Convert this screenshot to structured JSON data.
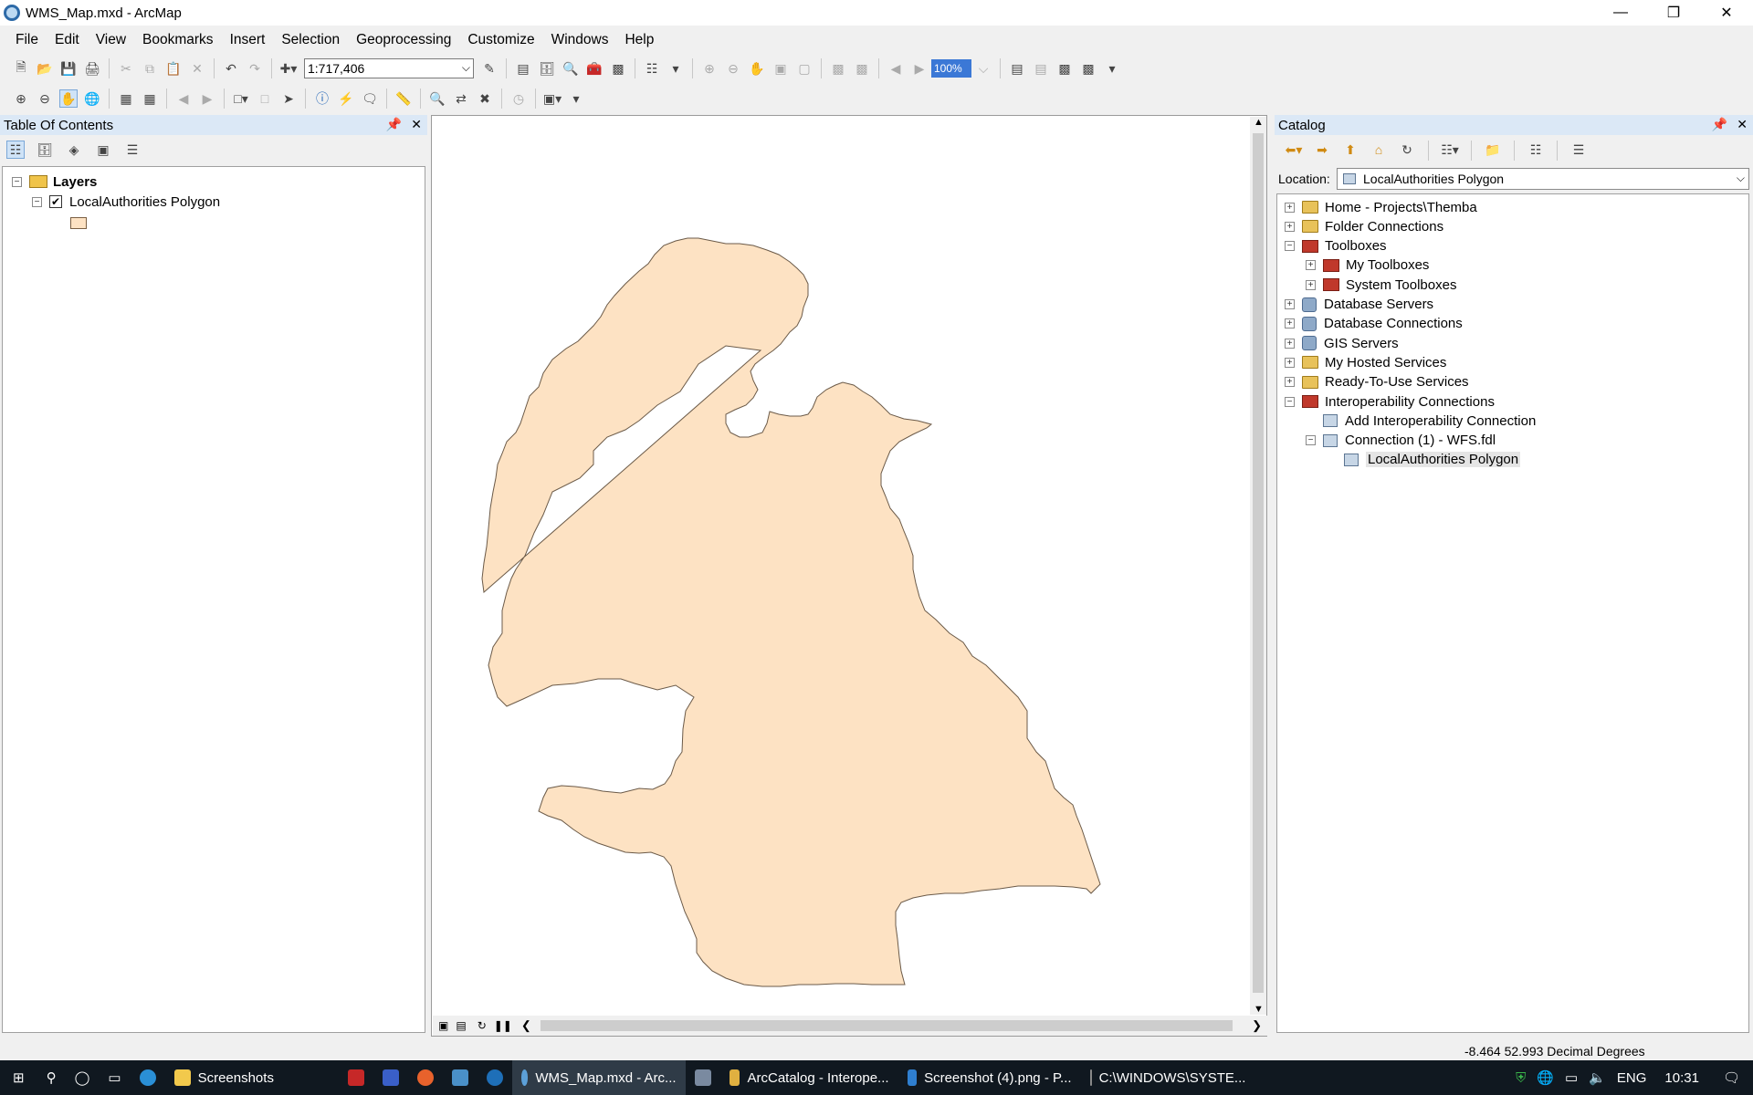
{
  "window": {
    "title": "WMS_Map.mxd - ArcMap"
  },
  "menu": [
    "File",
    "Edit",
    "View",
    "Bookmarks",
    "Insert",
    "Selection",
    "Geoprocessing",
    "Customize",
    "Windows",
    "Help"
  ],
  "toolbar": {
    "scale": "1:717,406",
    "zoom_percent": "100%"
  },
  "toc": {
    "title": "Table Of Contents",
    "root_label": "Layers",
    "layer_label": "LocalAuthorities Polygon",
    "layer_checked": true,
    "fill_color": "#fde2c3"
  },
  "catalog": {
    "title": "Catalog",
    "location_label": "Location:",
    "location_value": "LocalAuthorities Polygon",
    "tree": [
      {
        "label": "Home - Projects\\Themba",
        "indent": 0,
        "expander": "+",
        "icon": "folder-home-icon"
      },
      {
        "label": "Folder Connections",
        "indent": 0,
        "expander": "+",
        "icon": "folder-icon"
      },
      {
        "label": "Toolboxes",
        "indent": 0,
        "expander": "−",
        "icon": "toolbox-icon"
      },
      {
        "label": "My Toolboxes",
        "indent": 1,
        "expander": "+",
        "icon": "toolbox-icon"
      },
      {
        "label": "System Toolboxes",
        "indent": 1,
        "expander": "+",
        "icon": "toolbox-icon"
      },
      {
        "label": "Database Servers",
        "indent": 0,
        "expander": "+",
        "icon": "database-server-icon"
      },
      {
        "label": "Database Connections",
        "indent": 0,
        "expander": "+",
        "icon": "database-icon"
      },
      {
        "label": "GIS Servers",
        "indent": 0,
        "expander": "+",
        "icon": "gis-server-icon"
      },
      {
        "label": "My Hosted Services",
        "indent": 0,
        "expander": "+",
        "icon": "hosted-services-icon"
      },
      {
        "label": "Ready-To-Use Services",
        "indent": 0,
        "expander": "+",
        "icon": "ready-services-icon"
      },
      {
        "label": "Interoperability Connections",
        "indent": 0,
        "expander": "−",
        "icon": "interop-icon"
      },
      {
        "label": "Add Interoperability Connection",
        "indent": 1,
        "expander": "",
        "icon": "add-connection-icon"
      },
      {
        "label": "Connection (1) -  WFS.fdl",
        "indent": 1,
        "expander": "−",
        "icon": "connection-icon"
      },
      {
        "label": "LocalAuthorities Polygon",
        "indent": 2,
        "expander": "",
        "icon": "feature-class-icon"
      }
    ]
  },
  "status": {
    "coords": "-8.464  52.993 Decimal Degrees"
  },
  "taskbar": {
    "items": [
      "Screenshots",
      "WMS_Map.mxd - Arc...",
      "ArcCatalog - Interope...",
      "Screenshot (4).png - P...",
      "C:\\WINDOWS\\SYSTE..."
    ],
    "lang": "ENG",
    "time": "10:31"
  }
}
